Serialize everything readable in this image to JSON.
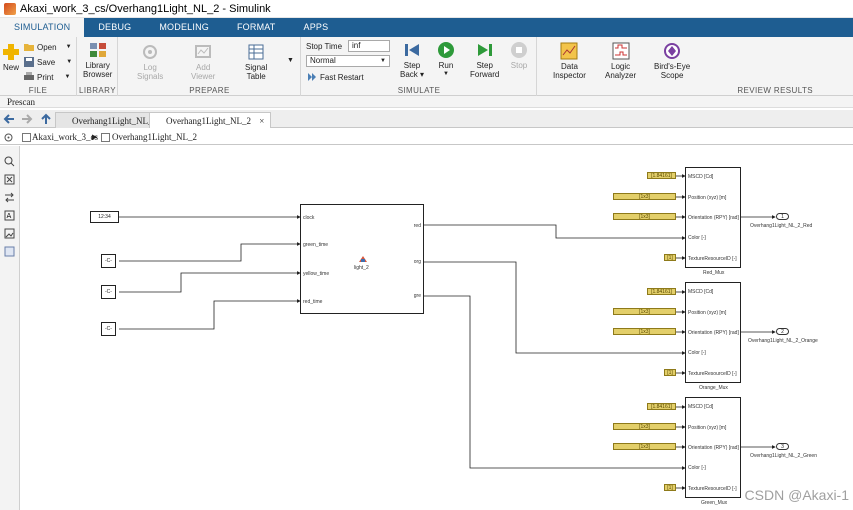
{
  "window": {
    "title": "Akaxi_work_3_cs/Overhang1Light_NL_2 - Simulink"
  },
  "ribbon_tabs": [
    "SIMULATION",
    "DEBUG",
    "MODELING",
    "FORMAT",
    "APPS"
  ],
  "ribbon": {
    "file": {
      "title": "FILE",
      "new": "New",
      "open": "Open",
      "save": "Save",
      "print": "Print"
    },
    "library": {
      "title": "LIBRARY",
      "browser_line1": "Library",
      "browser_line2": "Browser"
    },
    "prepare": {
      "title": "PREPARE",
      "log_signals_1": "Log",
      "log_signals_2": "Signals",
      "add_viewer_1": "Add",
      "add_viewer_2": "Viewer",
      "signal_table_1": "Signal",
      "signal_table_2": "Table"
    },
    "simulate": {
      "title": "SIMULATE",
      "stop_time_label": "Stop Time",
      "stop_time_value": "inf",
      "mode": "Normal",
      "fast_restart": "Fast Restart",
      "step_back_1": "Step",
      "step_back_2": "Back",
      "run": "Run",
      "step_forward_1": "Step",
      "step_forward_2": "Forward",
      "stop": "Stop"
    },
    "review": {
      "title": "REVIEW RESULTS",
      "data_inspector_1": "Data",
      "data_inspector_2": "Inspector",
      "logic_analyzer_1": "Logic",
      "logic_analyzer_2": "Analyzer",
      "birds_eye_1": "Bird's-Eye",
      "birds_eye_2": "Scope"
    }
  },
  "prescan_label": "Prescan",
  "doc_tabs": [
    {
      "label": "Overhang1Light_NL_1"
    },
    {
      "label": "Overhang1Light_NL_2",
      "close": "×"
    }
  ],
  "breadcrumb": {
    "root": "Akaxi_work_3_cs",
    "sep": "▶",
    "current": "Overhang1Light_NL_2"
  },
  "diagram": {
    "clock_display": "12:34",
    "const_label": "-C-",
    "subsystem": {
      "inputs": [
        "clock",
        "green_time",
        "yellow_time",
        "red_time"
      ],
      "outputs": [
        "red",
        "org",
        "gre"
      ],
      "name": "light_2"
    },
    "mux_inputs": [
      "MSCD [Cd]",
      "Position (xyz) [m]",
      "Orientation (RPY) [rad]",
      "Color [-]",
      "TextureResourceID [-]"
    ],
    "muxes": [
      {
        "name": "Red_Mux",
        "consts": [
          "[1.84161]",
          "[1x3]",
          "[1x3]",
          "[1]"
        ],
        "port": "1",
        "out_label": "Overhang1Light_NL_2_Red"
      },
      {
        "name": "Orange_Mux",
        "consts": [
          "[1.84161]",
          "[1x3]",
          "[1x3]",
          "[1]"
        ],
        "port": "2",
        "out_label": "Overhang1Light_NL_2_Orange"
      },
      {
        "name": "Green_Mux",
        "consts": [
          "[1.84161]",
          "[1x3]",
          "[1x3]",
          "[1]"
        ],
        "port": "3",
        "out_label": "Overhang1Light_NL_2_Green"
      }
    ]
  },
  "watermark": "CSDN @Akaxi-1",
  "colors": {
    "ribbon_blue": "#1e5d91",
    "const_yellow": "#e3cf6a",
    "run_green": "#2e9a3a"
  }
}
